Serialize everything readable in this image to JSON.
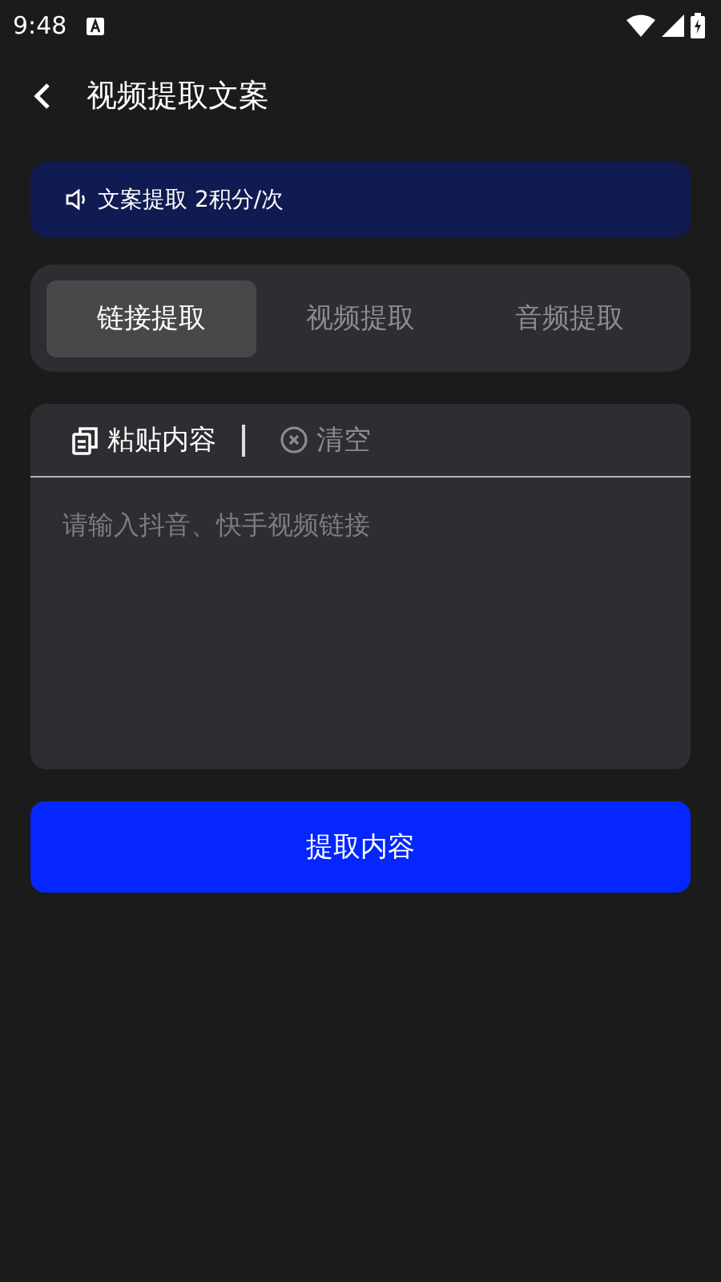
{
  "status_bar": {
    "time": "9:48"
  },
  "header": {
    "title": "视频提取文案"
  },
  "notice": {
    "text": "文案提取 2积分/次"
  },
  "tabs": [
    {
      "label": "链接提取",
      "selected": true
    },
    {
      "label": "视频提取",
      "selected": false
    },
    {
      "label": "音频提取",
      "selected": false
    }
  ],
  "toolbar": {
    "paste": "粘贴内容",
    "clear": "清空"
  },
  "input": {
    "placeholder": "请输入抖音、快手视频链接"
  },
  "submit_button": "提取内容"
}
